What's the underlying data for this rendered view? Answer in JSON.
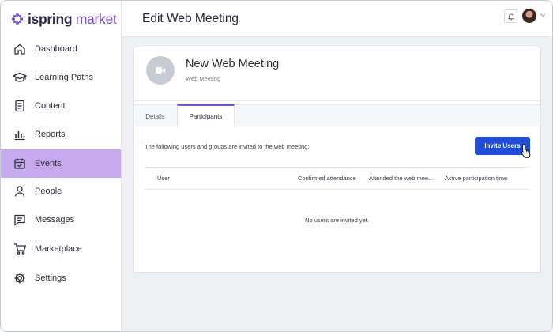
{
  "brand": {
    "name_part1": "ispring",
    "name_part2": "market",
    "accent": "#7a4fd1"
  },
  "sidebar": {
    "items": [
      {
        "label": "Dashboard",
        "icon": "home-icon"
      },
      {
        "label": "Learning Paths",
        "icon": "graduation-cap-icon"
      },
      {
        "label": "Content",
        "icon": "document-icon"
      },
      {
        "label": "Reports",
        "icon": "bar-chart-icon"
      },
      {
        "label": "Events",
        "icon": "calendar-check-icon",
        "active": true
      },
      {
        "label": "People",
        "icon": "person-icon"
      },
      {
        "label": "Messages",
        "icon": "message-icon"
      },
      {
        "label": "Marketplace",
        "icon": "cart-icon"
      },
      {
        "label": "Settings",
        "icon": "gear-icon"
      }
    ],
    "active_color": "#c7a9ee"
  },
  "header": {
    "title": "Edit Web Meeting"
  },
  "meeting": {
    "title": "New Web Meeting",
    "type": "Web Meeting"
  },
  "tabs": [
    {
      "label": "Details"
    },
    {
      "label": "Participants",
      "active": true
    }
  ],
  "participants": {
    "intro": "The following users and groups are invited to the web meeting:",
    "invite_button": "Invite Users",
    "columns": [
      "User",
      "Confirmed attendance",
      "Attended the web mee...",
      "Active participation time"
    ],
    "empty_text": "No users are invited yet."
  },
  "button_color": "#1f4fd8"
}
